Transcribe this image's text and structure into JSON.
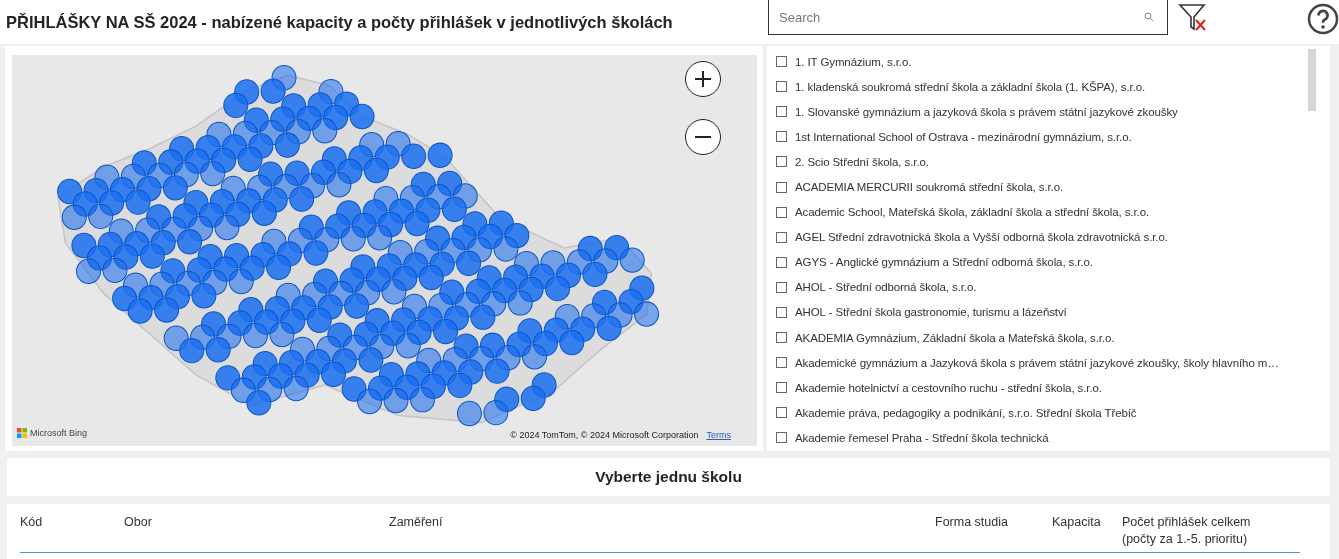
{
  "title": "PŘIHLÁŠKY NA SŠ 2024 - nabízené kapacity a počty přihlášek v jednotlivých školách",
  "search": {
    "placeholder": "Search"
  },
  "map": {
    "attribution": "© 2024 TomTom, © 2024 Microsoft Corporation",
    "terms_link": "Terms",
    "logo": "Microsoft Bing"
  },
  "schools": [
    {
      "label": "1. IT Gymnázium, s.r.o.",
      "checked": false
    },
    {
      "label": "1. kladenská soukromá střední škola a základní škola (1. KŠPA), s.r.o.",
      "checked": false
    },
    {
      "label": "1. Slovanské gymnázium a jazyková škola s právem státní jazykové zkoušky",
      "checked": false
    },
    {
      "label": "1st International School of Ostrava - mezinárodní gymnázium, s.r.o.",
      "checked": false
    },
    {
      "label": "2. Scio Střední škola, s.r.o.",
      "checked": false
    },
    {
      "label": "ACADEMIA MERCURII soukromá střední škola, s.r.o.",
      "checked": false
    },
    {
      "label": "Academic School, Mateřská škola, základní škola a střední škola, s.r.o.",
      "checked": false
    },
    {
      "label": "AGEL Střední zdravotnická škola a Vyšší odborná škola zdravotnická s.r.o.",
      "checked": false
    },
    {
      "label": "AGYS - Anglické gymnázium a Střední odborná škola, s.r.o.",
      "checked": false
    },
    {
      "label": "AHOL - Střední odborná škola, s.r.o.",
      "checked": false
    },
    {
      "label": "AHOL - Střední škola gastronomie, turismu a lázeňství",
      "checked": false
    },
    {
      "label": "AKADEMIA Gymnázium, Základní škola a Mateřská škola, s.r.o.",
      "checked": false
    },
    {
      "label": "Akademické gymnázium a Jazyková škola s právem státní jazykové zkoušky, školy hlavního m…",
      "checked": false
    },
    {
      "label": "Akademie hotelnictví a cestovního ruchu - střední škola, s.r.o.",
      "checked": false
    },
    {
      "label": "Akademie práva, pedagogiky a podnikání, s.r.o. Střední škola Třebíč",
      "checked": false
    },
    {
      "label": "Akademie řemesel Praha - Střední škola technická",
      "checked": false
    }
  ],
  "detail": {
    "title": "Vyberte jednu školu",
    "columns": [
      "Kód",
      "Obor",
      "Zaměření",
      "Forma studia",
      "Kapacita",
      "Počet přihlášek celkem (počty za 1.-5. prioritu)"
    ]
  }
}
